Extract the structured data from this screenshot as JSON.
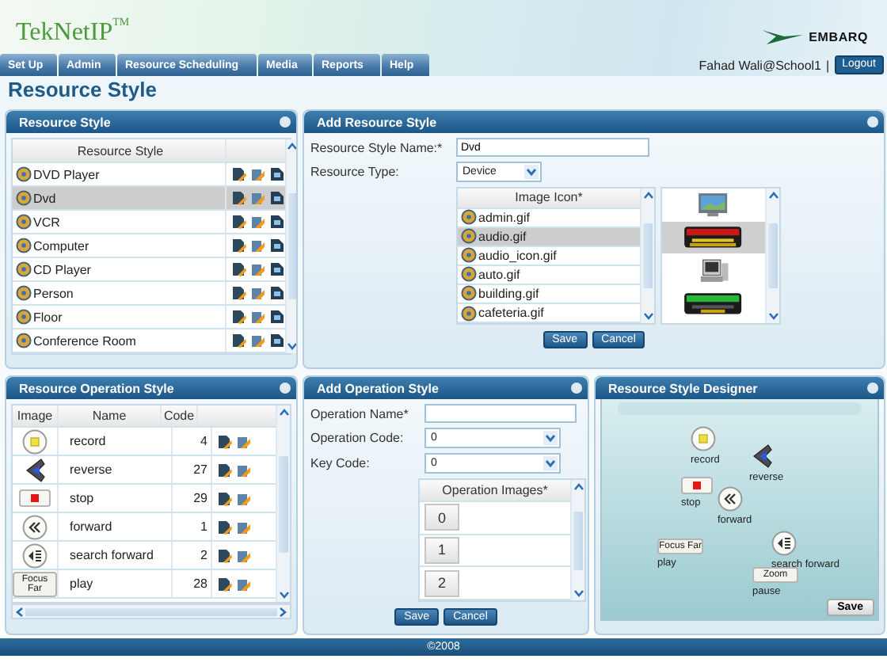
{
  "header": {
    "logo": "TekNetIP",
    "logo_mark": "TM",
    "brand": "EMBARQ",
    "user": "Fahad Wali@School1",
    "separator": "|",
    "logout": "Logout"
  },
  "nav": [
    {
      "label": "Set Up"
    },
    {
      "label": "Admin"
    },
    {
      "label": "Resource Scheduling"
    },
    {
      "label": "Media"
    },
    {
      "label": "Reports"
    },
    {
      "label": "Help"
    }
  ],
  "page_title": "Resource Style",
  "resource_style": {
    "title": "Resource Style",
    "column": "Resource Style",
    "rows": [
      {
        "name": "DVD Player",
        "selected": false
      },
      {
        "name": "Dvd",
        "selected": true
      },
      {
        "name": "VCR",
        "selected": false
      },
      {
        "name": "Computer",
        "selected": false
      },
      {
        "name": "CD Player",
        "selected": false
      },
      {
        "name": "Person",
        "selected": false
      },
      {
        "name": "Floor",
        "selected": false
      },
      {
        "name": "Conference Room",
        "selected": false
      }
    ]
  },
  "add_resource_style": {
    "title": "Add Resource Style",
    "name_label": "Resource Style Name:*",
    "name_value": "Dvd",
    "type_label": "Resource Type:",
    "type_value": "Device",
    "icon_column": "Image Icon*",
    "icons": [
      {
        "name": "admin.gif",
        "selected": false
      },
      {
        "name": "audio.gif",
        "selected": true
      },
      {
        "name": "audio_icon.gif",
        "selected": false
      },
      {
        "name": "auto.gif",
        "selected": false
      },
      {
        "name": "building.gif",
        "selected": false
      },
      {
        "name": "cafeteria.gif",
        "selected": false
      }
    ],
    "previews": [
      {
        "kind": "picture",
        "selected": false
      },
      {
        "kind": "picture",
        "selected": true
      },
      {
        "kind": "picture",
        "selected": false
      },
      {
        "kind": "picture",
        "selected": false
      }
    ],
    "buttons": [
      "Save",
      "Cancel"
    ]
  },
  "operation_style": {
    "title": "Resource Operation Style",
    "columns": [
      "Image",
      "Name",
      "Code"
    ],
    "rows": [
      {
        "image": {
          "kind": "disc"
        },
        "name": "record",
        "code": "4"
      },
      {
        "image": {
          "kind": "reverse"
        },
        "name": "reverse",
        "code": "27"
      },
      {
        "image": {
          "kind": "stop"
        },
        "name": "stop",
        "code": "29"
      },
      {
        "image": {
          "kind": "rewind"
        },
        "name": "forward",
        "code": "1"
      },
      {
        "image": {
          "kind": "search"
        },
        "name": "search forward",
        "code": "2"
      },
      {
        "image": {
          "kind": "label",
          "text": "Focus Far"
        },
        "name": "play",
        "code": "28"
      }
    ]
  },
  "add_operation_style": {
    "title": "Add Operation Style",
    "name_label": "Operation Name*",
    "code_label": "Operation Code:",
    "code_value": "0",
    "key_label": "Key Code:",
    "key_value": "0",
    "images_column": "Operation Images*",
    "images": [
      "0",
      "1",
      "2"
    ],
    "buttons": [
      "Save",
      "Cancel"
    ]
  },
  "designer": {
    "title": "Resource Style Designer",
    "items": [
      {
        "image": {
          "kind": "disc"
        },
        "label": "record"
      },
      {
        "image": {
          "kind": "reverse"
        },
        "label": "reverse"
      },
      {
        "image": {
          "kind": "stop"
        },
        "label": "stop"
      },
      {
        "image": {
          "kind": "rewind"
        },
        "label": "forward"
      },
      {
        "image": {
          "kind": "search"
        },
        "label": "search forward"
      },
      {
        "image": {
          "kind": "label",
          "text": "Focus Far"
        },
        "label": "play"
      },
      {
        "image": {
          "kind": "label",
          "text": "Zoom"
        },
        "label": "pause"
      }
    ],
    "button": "Save"
  },
  "footer": "©2008"
}
